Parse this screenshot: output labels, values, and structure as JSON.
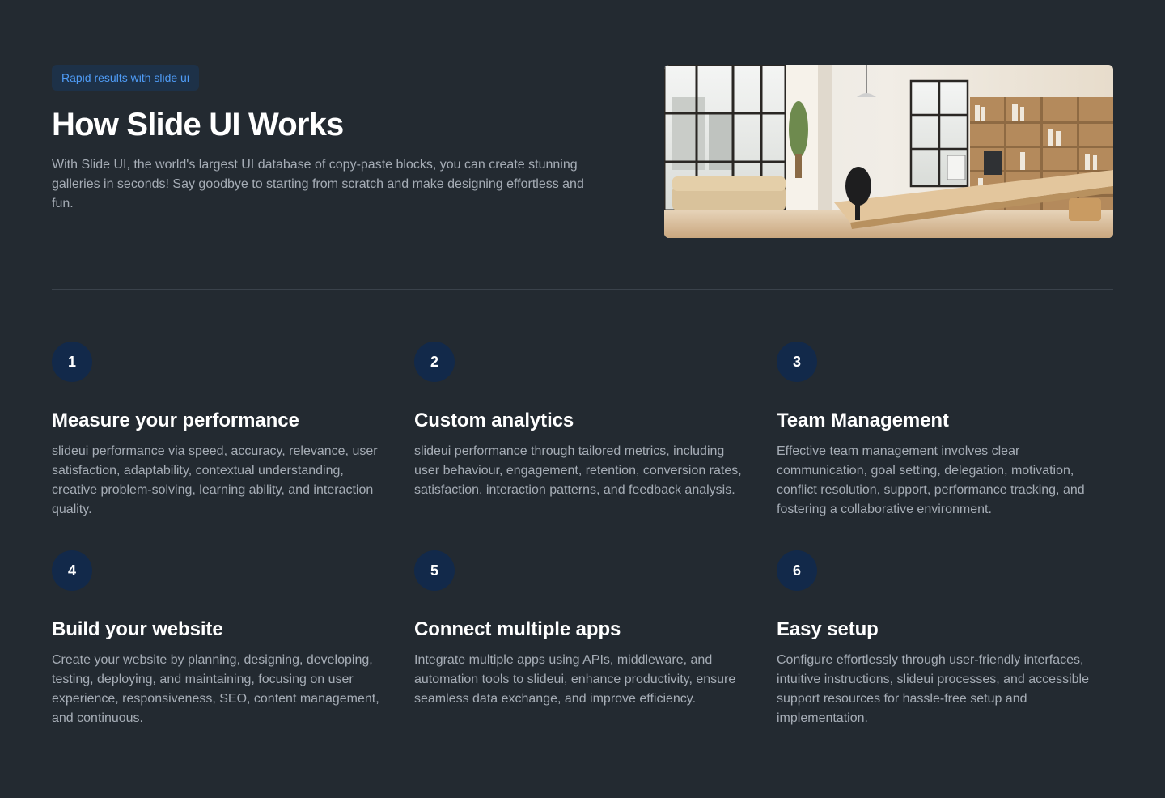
{
  "hero": {
    "badge": "Rapid results with slide ui",
    "title": "How Slide UI Works",
    "description": "With Slide UI, the world's largest UI database of copy-paste blocks, you can create stunning galleries in seconds! Say goodbye to starting from scratch and make designing effortless and fun."
  },
  "features": [
    {
      "number": "1",
      "title": "Measure your performance",
      "description": "slideui performance via speed, accuracy, relevance, user satisfaction, adaptability, contextual understanding, creative problem-solving, learning ability, and interaction quality."
    },
    {
      "number": "2",
      "title": "Custom analytics",
      "description": "slideui performance through tailored metrics, including user behaviour, engagement, retention, conversion rates, satisfaction, interaction patterns, and feedback analysis."
    },
    {
      "number": "3",
      "title": "Team Management",
      "description": "Effective team management involves clear communication, goal setting, delegation, motivation, conflict resolution, support, performance tracking, and fostering a collaborative environment."
    },
    {
      "number": "4",
      "title": "Build your website",
      "description": "Create your website by planning, designing, developing, testing, deploying, and maintaining, focusing on user experience, responsiveness, SEO, content management, and continuous."
    },
    {
      "number": "5",
      "title": "Connect multiple apps",
      "description": "Integrate multiple apps using APIs, middleware, and automation tools to slideui, enhance productivity, ensure seamless data exchange, and improve efficiency."
    },
    {
      "number": "6",
      "title": "Easy setup",
      "description": "Configure effortlessly through user-friendly interfaces, intuitive instructions, slideui processes, and accessible support resources for hassle-free setup and implementation."
    }
  ],
  "colors": {
    "background": "#232a31",
    "badge_bg": "#1d3148",
    "badge_text": "#4f9cf7",
    "number_circle": "#12294a",
    "muted_text": "#a6adb6",
    "divider": "#3a424b"
  }
}
